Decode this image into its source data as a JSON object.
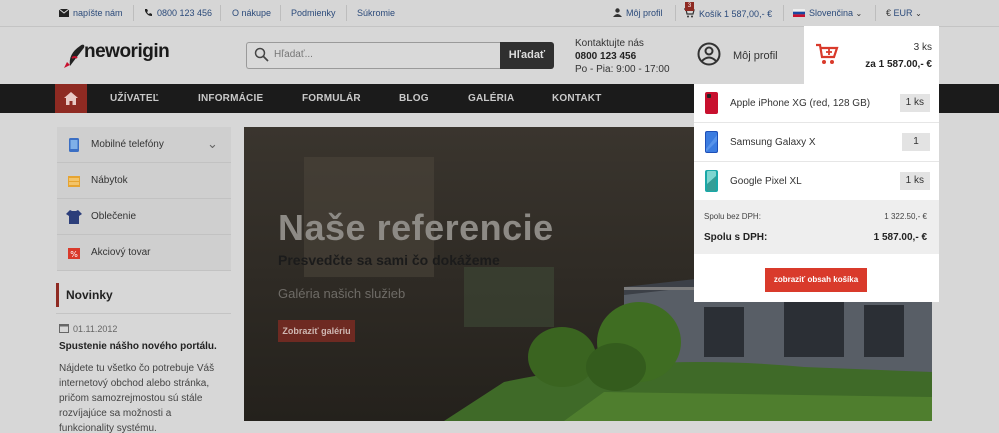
{
  "topbar": {
    "email": "napíšte nám",
    "phone": "0800 123 456",
    "links": [
      "O nákupe",
      "Podmienky",
      "Súkromie"
    ],
    "profile": "Môj profil",
    "cart": "Košík",
    "cart_badge": "3",
    "cart_amount": "1 587,00,- €",
    "language": "Slovenčina",
    "currency": "EUR"
  },
  "header": {
    "logo": "neworigin",
    "search_placeholder": "Hľadať...",
    "search_button": "Hľadať",
    "contact_title": "Kontaktujte nás",
    "contact_phone": "0800 123 456",
    "contact_hours": "Po - Pia: 9:00 - 17:00",
    "profile": "Môj profil",
    "cart_qty": "3 ks",
    "cart_total": "za 1 587.00,- €"
  },
  "nav": [
    "UŽÍVATEĽ",
    "INFORMÁCIE",
    "FORMULÁR",
    "BLOG",
    "GALÉRIA",
    "KONTAKT"
  ],
  "sidebar": {
    "items": [
      {
        "label": "Mobilné telefóny"
      },
      {
        "label": "Nábytok"
      },
      {
        "label": "Oblečenie"
      },
      {
        "label": "Akciový tovar"
      }
    ]
  },
  "news": {
    "title": "Novinky",
    "date": "01.11.2012",
    "headline": "Spustenie nášho nového portálu.",
    "text": "Nájdete tu všetko čo potrebuje Váš internetový obchod alebo stránka, pričom samozrejmostou sú stále rozvíjajúce sa možnosti a funkcionality systému."
  },
  "banner": {
    "title": "Naše referencie",
    "subtitle": "Presvedčte sa sami čo dokážeme",
    "subtitle2": "Galéria našich služieb",
    "button": "Zobraziť galériu"
  },
  "cart_dropdown": {
    "items": [
      {
        "name": "Apple iPhone XG (red, 128 GB)",
        "qty": "1 ks",
        "color": "#c8102e"
      },
      {
        "name": "Samsung Galaxy X",
        "qty": "1",
        "color": "#1d4fb8"
      },
      {
        "name": "Google Pixel XL",
        "qty": "1 ks",
        "color": "#1aa8a8"
      }
    ],
    "subtotal_label": "Spolu bez DPH:",
    "subtotal_value": "1 322.50,- €",
    "total_label": "Spolu s DPH:",
    "total_value": "1 587.00,- €",
    "show_button": "zobraziť obsah košíka"
  },
  "colors": {
    "accent": "#d93a2b",
    "nav_bg": "#1b1b1b"
  }
}
